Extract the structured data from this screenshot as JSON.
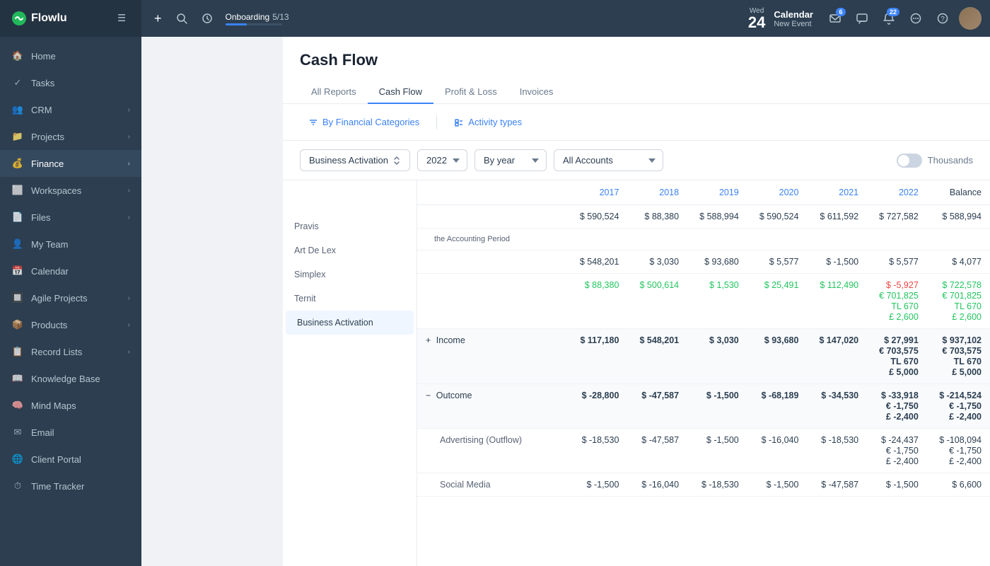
{
  "sidebar": {
    "logo": "Flowlu",
    "items": [
      {
        "id": "home",
        "label": "Home",
        "icon": "🏠",
        "hasArrow": false
      },
      {
        "id": "tasks",
        "label": "Tasks",
        "icon": "✓",
        "hasArrow": false
      },
      {
        "id": "crm",
        "label": "CRM",
        "icon": "👥",
        "hasArrow": true
      },
      {
        "id": "projects",
        "label": "Projects",
        "icon": "📁",
        "hasArrow": true
      },
      {
        "id": "finance",
        "label": "Finance",
        "icon": "💰",
        "hasArrow": true,
        "active": true
      },
      {
        "id": "workspaces",
        "label": "Workspaces",
        "icon": "⬜",
        "hasArrow": true
      },
      {
        "id": "files",
        "label": "Files",
        "icon": "📄",
        "hasArrow": true
      },
      {
        "id": "my-team",
        "label": "My Team",
        "icon": "👤",
        "hasArrow": false
      },
      {
        "id": "calendar",
        "label": "Calendar",
        "icon": "📅",
        "hasArrow": false
      },
      {
        "id": "agile",
        "label": "Agile Projects",
        "icon": "🔲",
        "hasArrow": true
      },
      {
        "id": "products",
        "label": "Products",
        "icon": "📦",
        "hasArrow": true
      },
      {
        "id": "record-lists",
        "label": "Record Lists",
        "icon": "📋",
        "hasArrow": true
      },
      {
        "id": "knowledge",
        "label": "Knowledge Base",
        "icon": "📖",
        "hasArrow": false
      },
      {
        "id": "mind-maps",
        "label": "Mind Maps",
        "icon": "🧠",
        "hasArrow": false
      },
      {
        "id": "email",
        "label": "Email",
        "icon": "✉",
        "hasArrow": false
      },
      {
        "id": "client-portal",
        "label": "Client Portal",
        "icon": "🌐",
        "hasArrow": false
      },
      {
        "id": "time-tracker",
        "label": "Time Tracker",
        "icon": "⏱",
        "hasArrow": false
      }
    ]
  },
  "topbar": {
    "add_label": "+",
    "search_label": "🔍",
    "onboarding_label": "Onboarding",
    "onboarding_progress": "5/13",
    "date_weekday": "Wed",
    "date_day": "24",
    "calendar_title": "Calendar",
    "calendar_subtitle": "New Event",
    "email_badge": "6",
    "notif_badge": "22"
  },
  "page": {
    "title": "Cash Flow",
    "tabs": [
      {
        "id": "all-reports",
        "label": "All Reports"
      },
      {
        "id": "cash-flow",
        "label": "Cash Flow",
        "active": true
      },
      {
        "id": "profit-loss",
        "label": "Profit & Loss"
      },
      {
        "id": "invoices",
        "label": "Invoices"
      }
    ]
  },
  "filters": {
    "by_financial": "By Financial Categories",
    "activity_types": "Activity types"
  },
  "toolbar": {
    "business_activation": "Business Activation",
    "year": "2022",
    "period": "By year",
    "accounts": "All Accounts",
    "thousands": "Thousands"
  },
  "table": {
    "years": [
      "2017",
      "2018",
      "2019",
      "2020",
      "2021",
      "2022",
      "Balance"
    ],
    "accounts_dropdown": [
      "All Accounts",
      "Pravis",
      "Art De Lex",
      "Simplex",
      "Ternit",
      "Business Activation"
    ],
    "account_rows": [
      {
        "name": "Pravis",
        "type": "account"
      },
      {
        "name": "Art De Lex",
        "type": "account"
      },
      {
        "name": "Simplex",
        "type": "account"
      },
      {
        "name": "Ternit",
        "type": "account"
      },
      {
        "name": "Business Activation",
        "type": "account",
        "highlighted": true
      }
    ],
    "rows": [
      {
        "label": "",
        "values": [
          "$ 590,524",
          "$ 88,380",
          "$ 588,994",
          "$ 590,524",
          "$ 611,592",
          "$ 727,582",
          "$ 588,994"
        ],
        "type": "normal"
      },
      {
        "label": "the Accounting Period",
        "values": [
          "",
          "",
          "",
          "",
          "",
          "",
          ""
        ],
        "type": "sub-label"
      },
      {
        "label": "",
        "values": [
          "$ 548,201",
          "$ 3,030",
          "$ 93,680",
          "$ 5,577",
          "$ -1,500",
          "$ 5,577",
          "$ 4,077"
        ],
        "type": "normal"
      },
      {
        "label": "",
        "values": [
          "$ 88,380",
          "$ 500,614",
          "$ 1,530",
          "$ 25,491",
          "$ 112,490",
          "$ -5,927\n€ 701,825\nTL 670\n£ 2,600",
          "$ 722,578\n€ 701,825\nTL 670\n£ 2,600"
        ],
        "color": "green",
        "type": "multiline"
      },
      {
        "label": "+ Income",
        "values": [
          "$ 117,180",
          "$ 548,201",
          "$ 3,030",
          "$ 93,680",
          "$ 147,020",
          "$ 27,991\n€ 703,575\nTL 670\n£ 5,000",
          "$ 937,102\n€ 703,575\nTL 670\n£ 5,000"
        ],
        "type": "section-income"
      },
      {
        "label": "- Outcome",
        "values": [
          "$ -28,800",
          "$ -47,587",
          "$ -1,500",
          "$ -68,189",
          "$ -34,530",
          "$ -33,918\n€ -1,750\n£ -2,400",
          "$ -214,524\n€ -1,750\n£ -2,400"
        ],
        "type": "section-outcome"
      },
      {
        "label": "Advertising (Outflow)",
        "values": [
          "$ -18,530",
          "$ -47,587",
          "$ -1,500",
          "$ -16,040",
          "$ -18,530",
          "$ -24,437\n€ -1,750\n£ -2,400",
          "$ -108,094\n€ -1,750\n£ -2,400"
        ],
        "type": "sub"
      },
      {
        "label": "Social Media",
        "values": [
          "$ -1,500",
          "$ -16,040",
          "$ -18,530",
          "$ -1,500",
          "$ -47,587",
          "$ -1,500",
          "$ 6,600"
        ],
        "type": "sub"
      }
    ]
  }
}
